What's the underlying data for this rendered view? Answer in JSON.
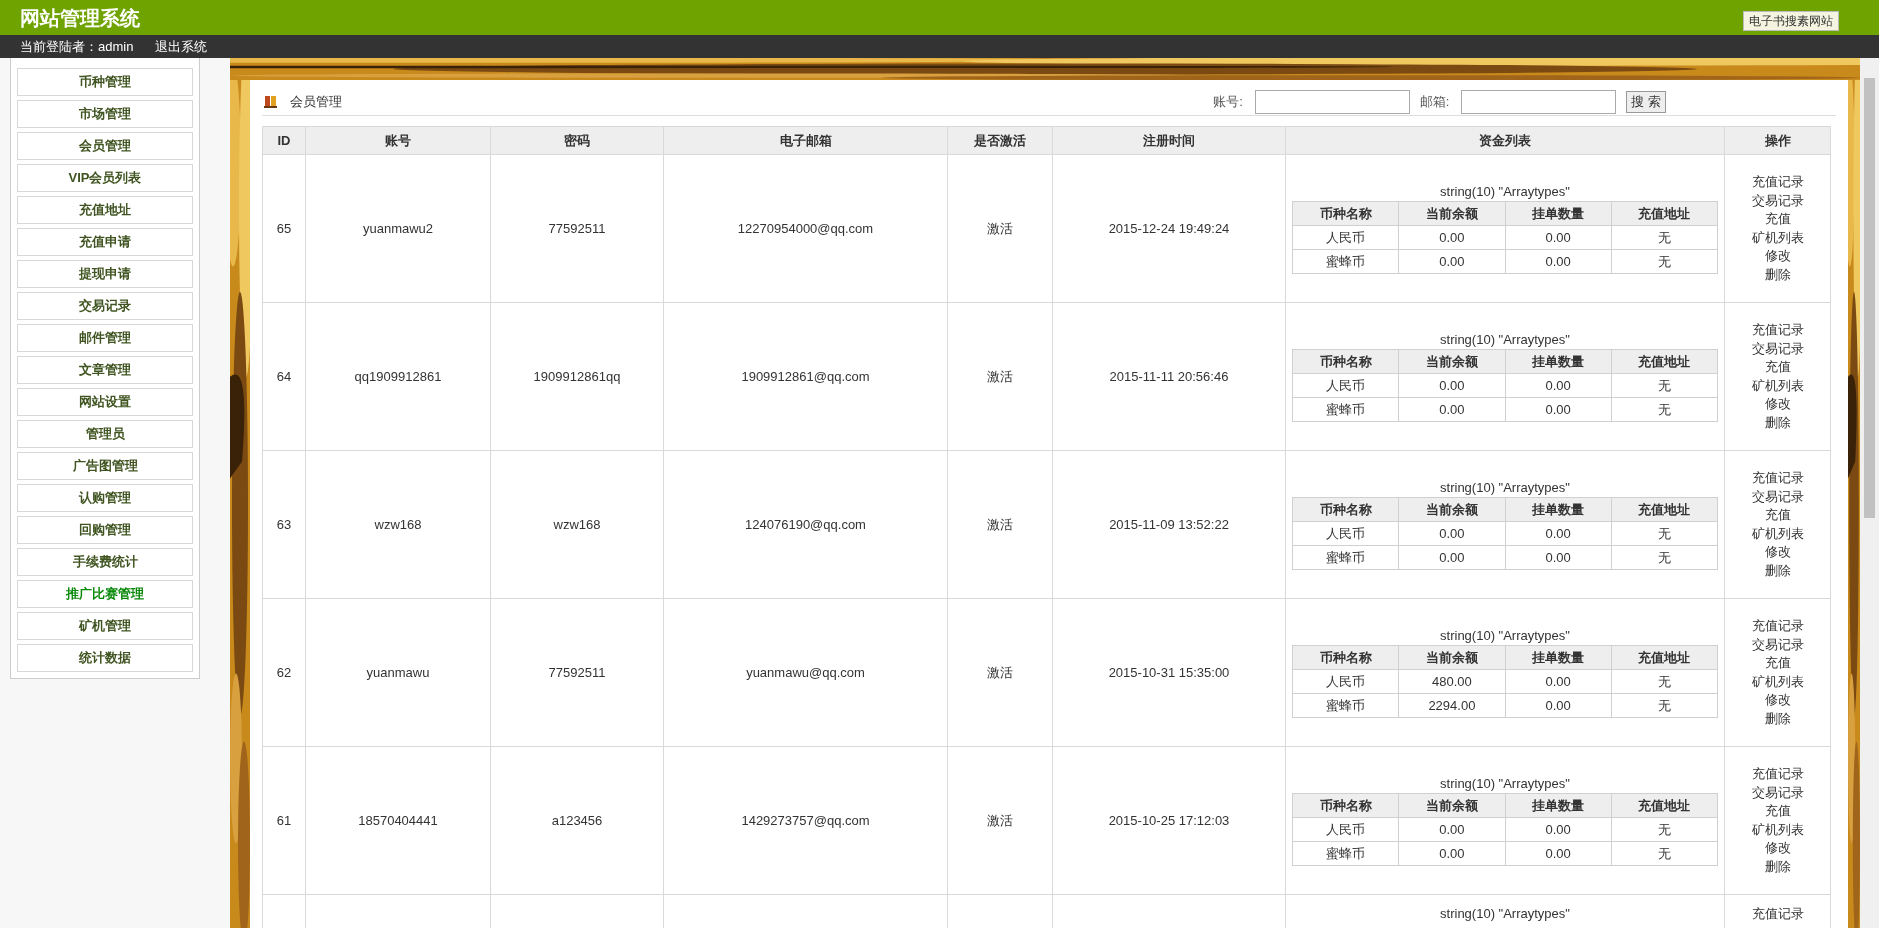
{
  "header": {
    "title": "网站管理系统",
    "link": "电子书搜素网站"
  },
  "user_bar": {
    "user_label": "当前登陆者：admin",
    "logout": "退出系统"
  },
  "sidebar": {
    "items": [
      {
        "label": "币种管理",
        "selected": false
      },
      {
        "label": "市场管理",
        "selected": false
      },
      {
        "label": "会员管理",
        "selected": false
      },
      {
        "label": "VIP会员列表",
        "selected": false
      },
      {
        "label": "充值地址",
        "selected": false
      },
      {
        "label": "充值申请",
        "selected": false
      },
      {
        "label": "提现申请",
        "selected": false
      },
      {
        "label": "交易记录",
        "selected": false
      },
      {
        "label": "邮件管理",
        "selected": false
      },
      {
        "label": "文章管理",
        "selected": false
      },
      {
        "label": "网站设置",
        "selected": false
      },
      {
        "label": "管理员",
        "selected": false
      },
      {
        "label": "广告图管理",
        "selected": false
      },
      {
        "label": "认购管理",
        "selected": false
      },
      {
        "label": "回购管理",
        "selected": false
      },
      {
        "label": "手续费统计",
        "selected": false
      },
      {
        "label": "推广比赛管理",
        "selected": true
      },
      {
        "label": "矿机管理",
        "selected": false
      },
      {
        "label": "统计数据",
        "selected": false
      }
    ]
  },
  "panel": {
    "title": "会员管理",
    "search": {
      "account_label": "账号:",
      "email_label": "邮箱:",
      "button": "搜 索"
    }
  },
  "table": {
    "columns": [
      "ID",
      "账号",
      "密码",
      "电子邮箱",
      "是否激活",
      "注册时间",
      "资金列表",
      "操作"
    ],
    "rows": [
      {
        "id": "65",
        "account": "yuanmawu2",
        "password": "77592511",
        "email": "12270954000@qq.com",
        "active": "激活",
        "time": "2015-12-24 19:49:24",
        "caption": "string(10) \"Arraytypes\"",
        "fund_columns": [
          "币种名称",
          "当前余额",
          "挂单数量",
          "充值地址"
        ],
        "funds": [
          [
            "人民币",
            "0.00",
            "0.00",
            "无"
          ],
          [
            "蜜蜂币",
            "0.00",
            "0.00",
            "无"
          ]
        ],
        "actions": [
          "充值记录",
          "交易记录",
          "充值",
          "矿机列表",
          "修改",
          "删除"
        ]
      },
      {
        "id": "64",
        "account": "qq1909912861",
        "password": "1909912861qq",
        "email": "1909912861@qq.com",
        "active": "激活",
        "time": "2015-11-11 20:56:46",
        "caption": "string(10) \"Arraytypes\"",
        "fund_columns": [
          "币种名称",
          "当前余额",
          "挂单数量",
          "充值地址"
        ],
        "funds": [
          [
            "人民币",
            "0.00",
            "0.00",
            "无"
          ],
          [
            "蜜蜂币",
            "0.00",
            "0.00",
            "无"
          ]
        ],
        "actions": [
          "充值记录",
          "交易记录",
          "充值",
          "矿机列表",
          "修改",
          "删除"
        ]
      },
      {
        "id": "63",
        "account": "wzw168",
        "password": "wzw168",
        "email": "124076190@qq.com",
        "active": "激活",
        "time": "2015-11-09 13:52:22",
        "caption": "string(10) \"Arraytypes\"",
        "fund_columns": [
          "币种名称",
          "当前余额",
          "挂单数量",
          "充值地址"
        ],
        "funds": [
          [
            "人民币",
            "0.00",
            "0.00",
            "无"
          ],
          [
            "蜜蜂币",
            "0.00",
            "0.00",
            "无"
          ]
        ],
        "actions": [
          "充值记录",
          "交易记录",
          "充值",
          "矿机列表",
          "修改",
          "删除"
        ]
      },
      {
        "id": "62",
        "account": "yuanmawu",
        "password": "77592511",
        "email": "yuanmawu@qq.com",
        "active": "激活",
        "time": "2015-10-31 15:35:00",
        "caption": "string(10) \"Arraytypes\"",
        "fund_columns": [
          "币种名称",
          "当前余额",
          "挂单数量",
          "充值地址"
        ],
        "funds": [
          [
            "人民币",
            "480.00",
            "0.00",
            "无"
          ],
          [
            "蜜蜂币",
            "2294.00",
            "0.00",
            "无"
          ]
        ],
        "actions": [
          "充值记录",
          "交易记录",
          "充值",
          "矿机列表",
          "修改",
          "删除"
        ]
      },
      {
        "id": "61",
        "account": "18570404441",
        "password": "a123456",
        "email": "1429273757@qq.com",
        "active": "激活",
        "time": "2015-10-25 17:12:03",
        "caption": "string(10) \"Arraytypes\"",
        "fund_columns": [
          "币种名称",
          "当前余额",
          "挂单数量",
          "充值地址"
        ],
        "funds": [
          [
            "人民币",
            "0.00",
            "0.00",
            "无"
          ],
          [
            "蜜蜂币",
            "0.00",
            "0.00",
            "无"
          ]
        ],
        "actions": [
          "充值记录",
          "交易记录",
          "充值",
          "矿机列表",
          "修改",
          "删除"
        ]
      }
    ],
    "partial_row": {
      "caption": "string(10) \"Arraytypes\"",
      "action": "充值记录"
    }
  }
}
